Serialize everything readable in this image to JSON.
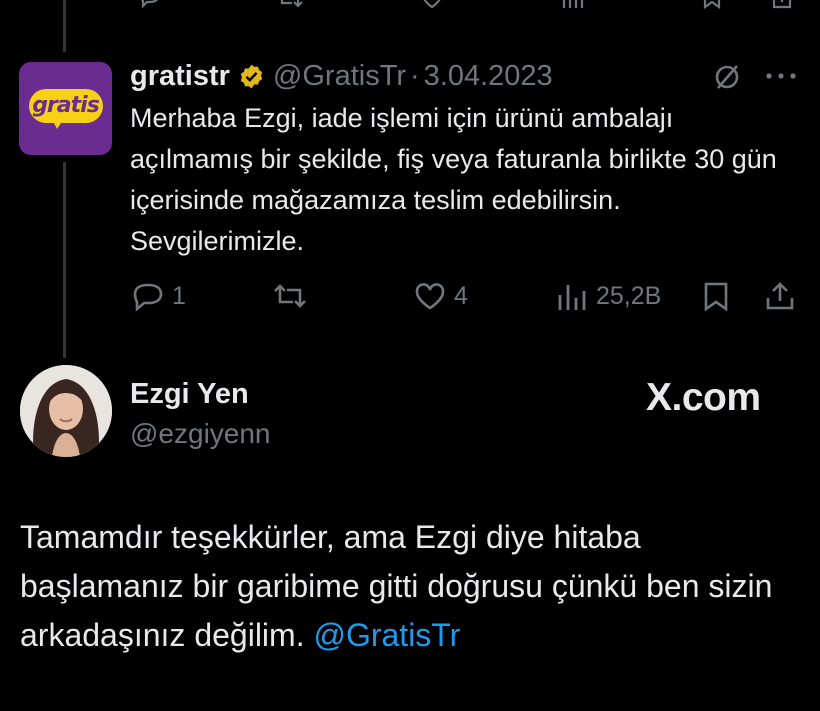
{
  "thread": {
    "top_actions": [
      "reply-icon",
      "retweet-icon",
      "like-icon",
      "views-icon",
      "bookmark-icon"
    ]
  },
  "tweet": {
    "avatar_text": "gratis",
    "name": "gratistr",
    "verified": true,
    "handle": "@GratisTr",
    "separator": "·",
    "date": "3.04.2023",
    "text": "Merhaba Ezgi, iade işlemi için ürünü ambalajı açılmamış bir şekilde, fiş veya faturanla birlikte 30 gün içerisinde mağazamıza teslim edebilirsin. Sevgilerimizle.",
    "actions": {
      "replies": "1",
      "retweets": "",
      "likes": "4",
      "views": "25,2B"
    }
  },
  "reply": {
    "name": "Ezgi Yen",
    "handle": "@ezgiyenn",
    "brand": "X.com",
    "text": "Tamamdır teşekkürler, ama Ezgi diye hitaba başlamanız bir garibime gitti doğrusu çünkü ben sizin arkadaşınız değilim.",
    "mention": "@GratisTr"
  },
  "colors": {
    "background": "#000000",
    "text": "#e7e9ea",
    "muted": "#71767b",
    "link": "#1d9bf0",
    "verified": "#e2b719",
    "gratis_purple": "#6a2c91",
    "gratis_yellow": "#f7d116"
  }
}
